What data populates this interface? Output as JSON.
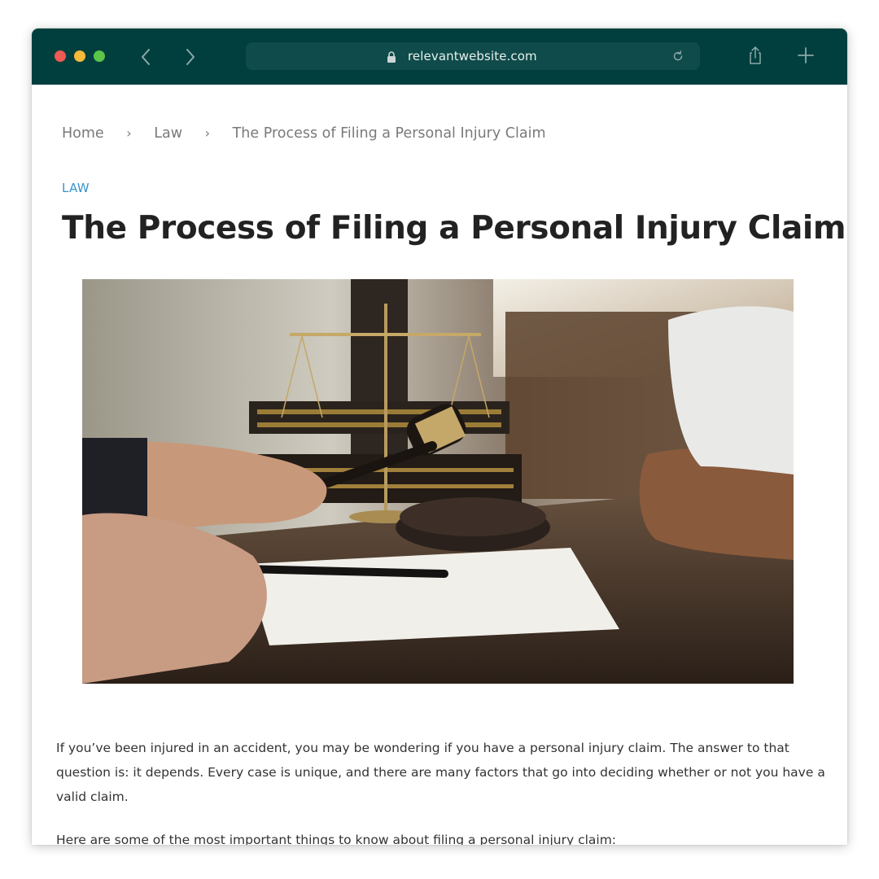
{
  "browser": {
    "url": "relevantwebsite.com",
    "toolbar_color": "#013f3e",
    "icons": [
      "back-arrow-icon",
      "forward-arrow-icon",
      "lock-icon",
      "reload-icon",
      "share-icon",
      "new-tab-plus-icon"
    ]
  },
  "breadcrumb": {
    "items": [
      "Home",
      "Law",
      "The Process of Filing a Personal Injury Claim"
    ],
    "separator": "›"
  },
  "article": {
    "category": "LAW",
    "title": "The Process of Filing a Personal Injury Claim",
    "paragraphs": [
      "If you’ve been injured in an accident, you may be wondering if you have a personal injury claim. The answer to that question is: it depends. Every case is unique, and there are many factors that go into deciding whether or not you have a valid claim.",
      "Here are some of the most important things to know about filing a personal injury claim:"
    ]
  },
  "colors": {
    "category_link": "#3a94d1",
    "title_text": "#222222",
    "body_text": "#333333",
    "breadcrumb_text": "#7a7a7a"
  }
}
